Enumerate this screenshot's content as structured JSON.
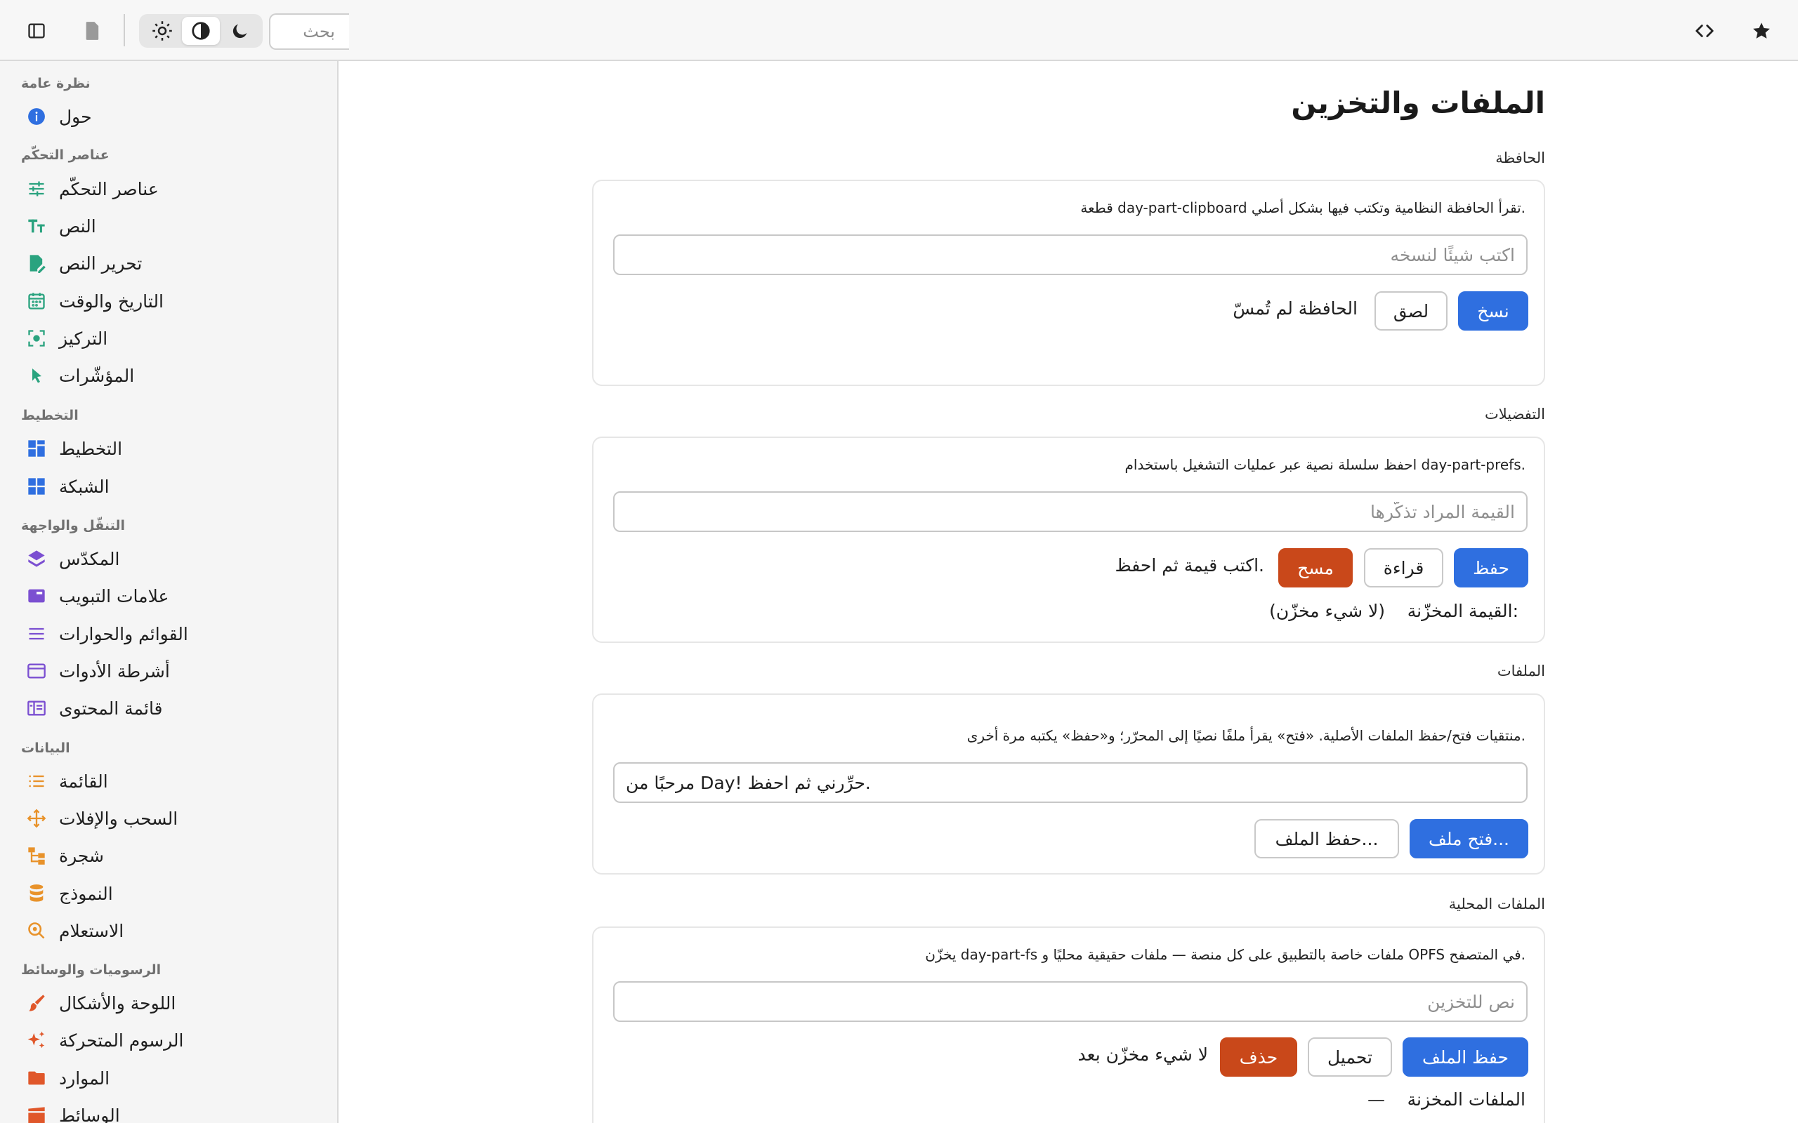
{
  "topbar": {
    "search_placeholder": "بحث",
    "theme_modes": [
      "light",
      "auto",
      "dark"
    ],
    "active_theme": "auto"
  },
  "sidebar": {
    "sections": [
      {
        "title": "نظرة عامة",
        "items": [
          {
            "label": "حول",
            "icon": "info-icon",
            "color": "#2f6fe0"
          }
        ]
      },
      {
        "title": "عناصر التحكّم",
        "items": [
          {
            "label": "عناصر التحكّم",
            "icon": "sliders-icon",
            "color": "#2aa37f"
          },
          {
            "label": "النص",
            "icon": "text-size-icon",
            "color": "#2aa37f"
          },
          {
            "label": "تحرير النص",
            "icon": "edit-document-icon",
            "color": "#2aa37f"
          },
          {
            "label": "التاريخ والوقت",
            "icon": "calendar-icon",
            "color": "#2aa37f"
          },
          {
            "label": "التركيز",
            "icon": "focus-icon",
            "color": "#2aa37f"
          },
          {
            "label": "المؤشّرات",
            "icon": "cursor-icon",
            "color": "#2aa37f"
          }
        ]
      },
      {
        "title": "التخطيط",
        "items": [
          {
            "label": "التخطيط",
            "icon": "layout-icon",
            "color": "#2f6fe0"
          },
          {
            "label": "الشبكة",
            "icon": "grid-icon",
            "color": "#2f6fe0"
          }
        ]
      },
      {
        "title": "التنقّل والواجهة",
        "items": [
          {
            "label": "المكدّس",
            "icon": "layers-icon",
            "color": "#7b4fd1"
          },
          {
            "label": "علامات التبويب",
            "icon": "tabs-icon",
            "color": "#7b4fd1"
          },
          {
            "label": "القوائم والحوارات",
            "icon": "menu-icon",
            "color": "#7b4fd1"
          },
          {
            "label": "أشرطة الأدوات",
            "icon": "toolbar-icon",
            "color": "#7b4fd1"
          },
          {
            "label": "قائمة المحتوى",
            "icon": "content-list-icon",
            "color": "#7b4fd1"
          }
        ]
      },
      {
        "title": "البيانات",
        "items": [
          {
            "label": "القائمة",
            "icon": "list-icon",
            "color": "#e8922a"
          },
          {
            "label": "السحب والإفلات",
            "icon": "move-icon",
            "color": "#e8922a"
          },
          {
            "label": "شجرة",
            "icon": "tree-icon",
            "color": "#e8922a"
          },
          {
            "label": "النموذج",
            "icon": "database-icon",
            "color": "#e8922a"
          },
          {
            "label": "الاستعلام",
            "icon": "query-icon",
            "color": "#e8922a"
          }
        ]
      },
      {
        "title": "الرسوميات والوسائط",
        "items": [
          {
            "label": "اللوحة والأشكال",
            "icon": "brush-icon",
            "color": "#e0572a"
          },
          {
            "label": "الرسوم المتحركة",
            "icon": "sparkle-icon",
            "color": "#e0572a"
          },
          {
            "label": "الموارد",
            "icon": "folder-icon",
            "color": "#e0572a"
          },
          {
            "label": "الوسائط",
            "icon": "clapper-icon",
            "color": "#e0572a"
          }
        ]
      }
    ]
  },
  "main": {
    "title": "الملفات والتخزين",
    "clipboard": {
      "label": "الحافظة",
      "desc": ".تقرأ الحافظة النظامية وتكتب فيها بشكل أصلي day-part-clipboard قطعة",
      "input_placeholder": "اكتب شيئًا لنسخه",
      "copy_label": "نسخ",
      "paste_label": "لصق",
      "status": "الحافظة لم تُمسّ"
    },
    "prefs": {
      "label": "التفضيلات",
      "desc": ".day-part-prefs احفظ سلسلة نصية عبر عمليات التشغيل باستخدام",
      "input_placeholder": "القيمة المراد تذكّرها",
      "save_label": "حفظ",
      "read_label": "قراءة",
      "clear_label": "مسح",
      "hint": ".اكتب قيمة ثم احفظ",
      "stored_label": ":القيمة المخزّنة",
      "stored_value": "(لا شيء مخزّن)"
    },
    "files": {
      "label": "الملفات",
      "desc": ".منتقيات فتح/حفظ الملفات الأصلية. «فتح» يقرأ ملفًا نصيًا إلى المحرّر؛ و«حفظ» يكتبه مرة أخرى",
      "editor_value": "مرحبًا من Day! حرِّرني ثم احفظ.",
      "open_label": "...فتح ملف",
      "save_label": "...حفظ الملف"
    },
    "local_files": {
      "label": "الملفات المحلية",
      "desc": ".في المتصفح OPFS ملفات خاصة بالتطبيق على كل منصة — ملفات حقيقية محليًا و day-part-fs يخزّن",
      "input_placeholder": "نص للتخزين",
      "save_label": "حفظ الملف",
      "load_label": "تحميل",
      "delete_label": "حذف",
      "status": "لا شيء مخزّن بعد",
      "stored_files_label": "الملفات المخزنة",
      "stored_files_value": "—"
    }
  }
}
